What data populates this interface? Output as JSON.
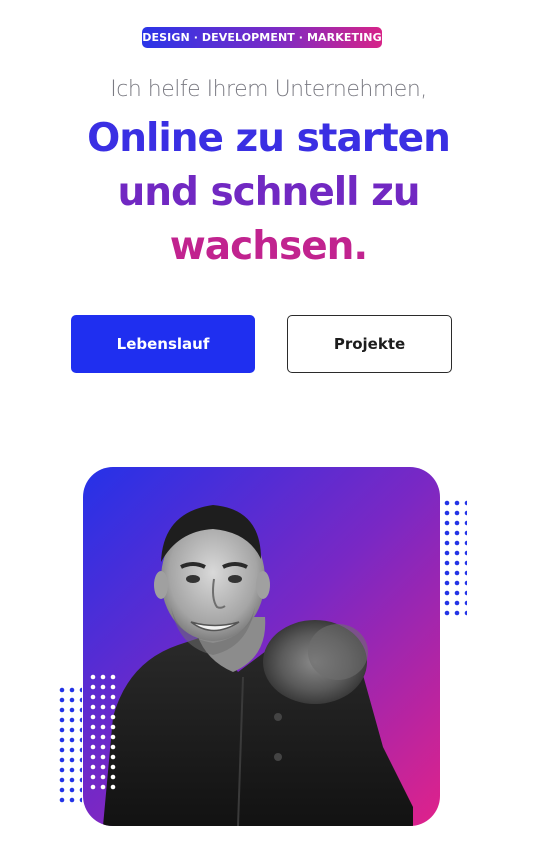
{
  "badge": {
    "label": "DESIGN · DEVELOPMENT · MARKETING"
  },
  "hero": {
    "intro": "Ich helfe Ihrem Unternehmen,",
    "headline_line1": "Online zu starten",
    "headline_line2": "und schnell zu",
    "headline_line3": "wachsen."
  },
  "buttons": {
    "primary_label": "Lebenslauf",
    "secondary_label": "Projekte"
  },
  "photo": {
    "alt": "Porträtfoto"
  },
  "colors": {
    "accent_blue": "#1f2ff0",
    "accent_purple": "#7128c2",
    "accent_pink": "#c1238f",
    "dot_blue": "#2434e6"
  }
}
